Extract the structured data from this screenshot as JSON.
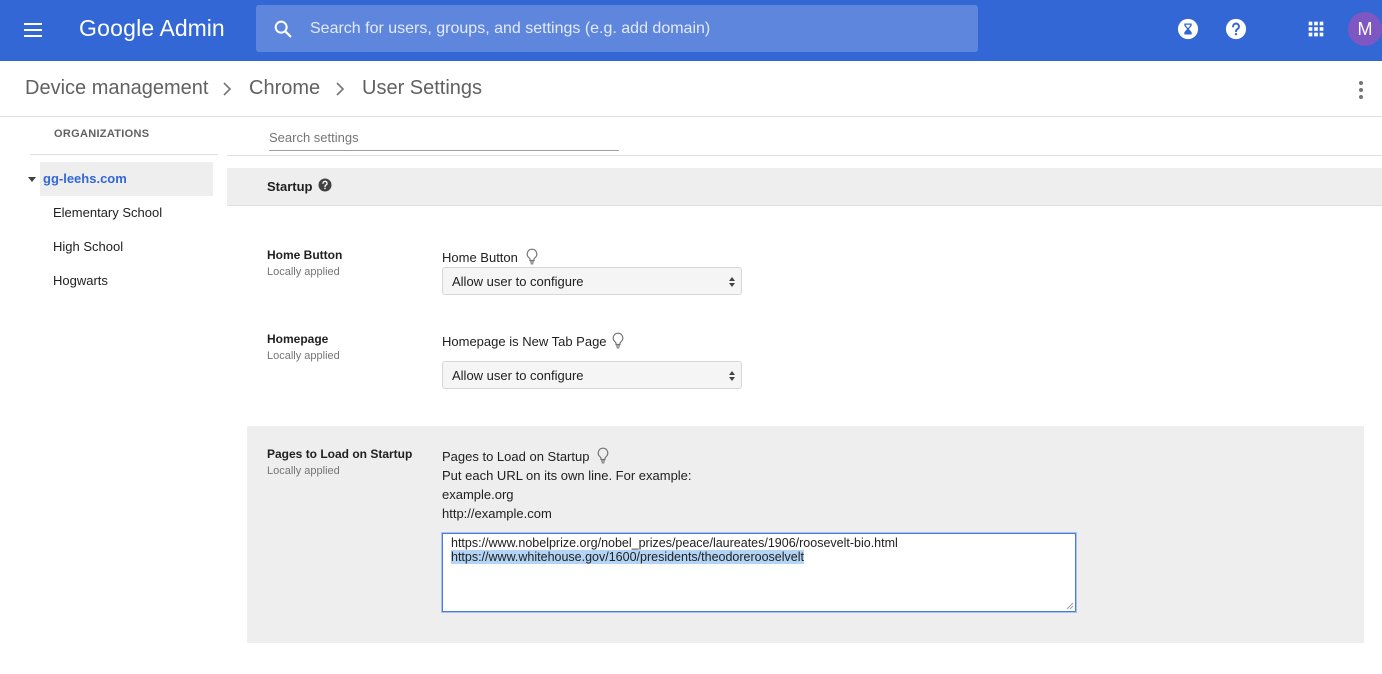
{
  "app": {
    "logo_google": "Google",
    "logo_admin": "Admin",
    "avatar_letter": "M"
  },
  "search": {
    "placeholder": "Search for users, groups, and settings (e.g. add domain)"
  },
  "icons": {
    "menu": "menu-icon",
    "search": "search-icon",
    "hourglass": "hourglass-icon",
    "help": "help-icon",
    "apps": "apps-grid-icon",
    "more": "more-vert-icon",
    "bulb": "lightbulb-icon"
  },
  "breadcrumb": {
    "items": [
      "Device management",
      "Chrome",
      "User Settings"
    ]
  },
  "sidebar": {
    "heading": "ORGANIZATIONS",
    "root": "gg-leehs.com",
    "children": [
      "Elementary School",
      "High School",
      "Hogwarts"
    ]
  },
  "settings_search": {
    "placeholder": "Search settings"
  },
  "section": {
    "title": "Startup"
  },
  "settings": {
    "home_button": {
      "name": "Home Button",
      "applied": "Locally applied",
      "field_label": "Home Button",
      "value": "Allow user to configure"
    },
    "homepage": {
      "name": "Homepage",
      "applied": "Locally applied",
      "field_label": "Homepage is New Tab Page",
      "value": "Allow user to configure"
    },
    "pages_on_startup": {
      "name": "Pages to Load on Startup",
      "applied": "Locally applied",
      "field_label": "Pages to Load on Startup",
      "help_lines": [
        "Put each URL on its own line. For example:",
        "example.org",
        "http://example.com"
      ],
      "urls": [
        "https://www.nobelprize.org/nobel_prizes/peace/laureates/1906/roosevelt-bio.html",
        "https://www.whitehouse.gov/1600/presidents/theodorerooselvelt"
      ]
    }
  },
  "colors": {
    "topbar": "#3367d6",
    "search_box": "#5f86dd",
    "link": "#3367d6",
    "panel": "#eeeeee",
    "selection": "#b3d4f5"
  }
}
